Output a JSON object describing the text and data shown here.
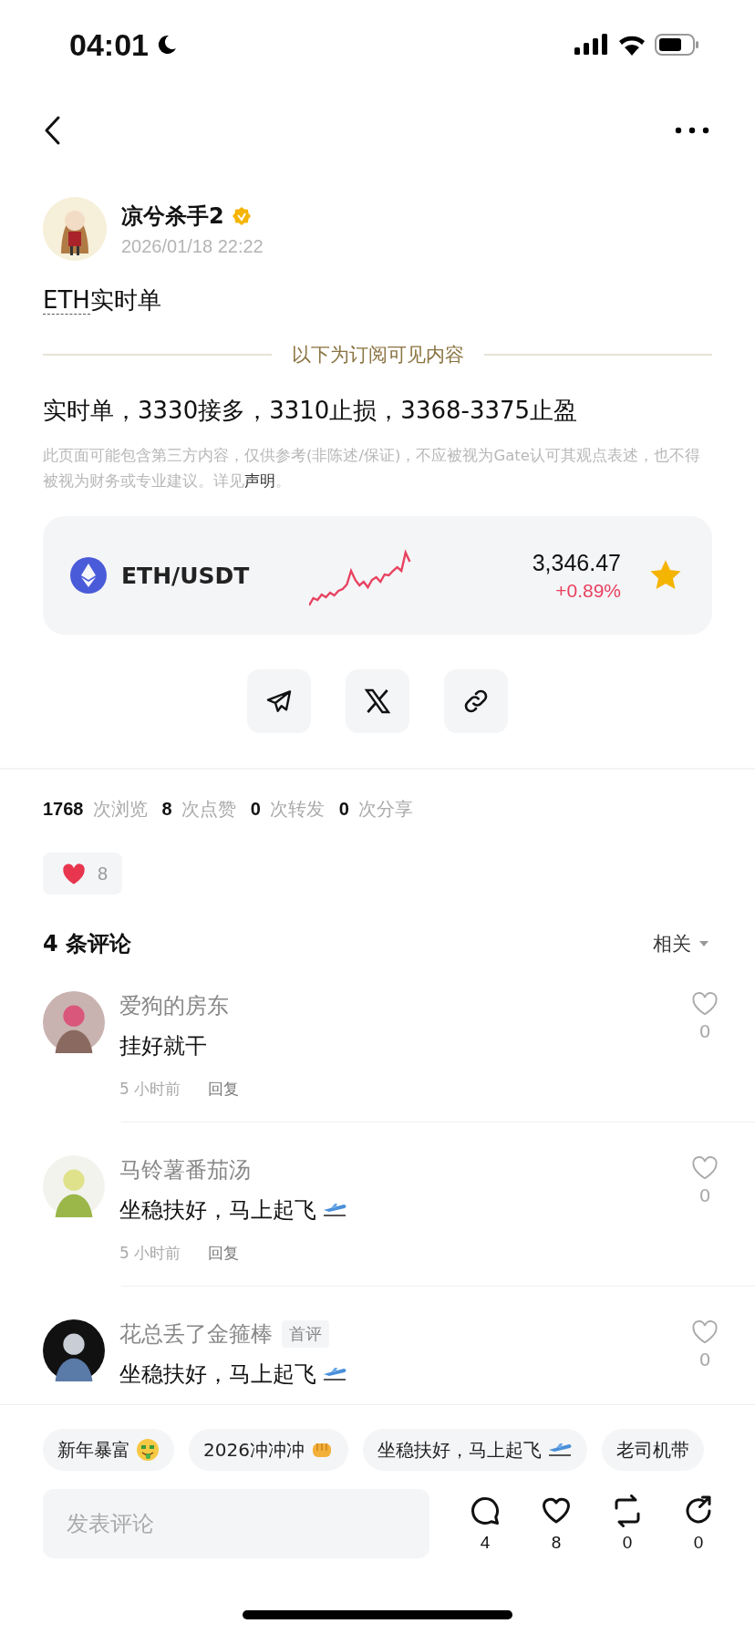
{
  "status_bar": {
    "time": "04:01"
  },
  "author": {
    "name": "凉兮杀手2",
    "verified": true,
    "date": "2026/01/18 22:22"
  },
  "post": {
    "title_tag": "ETH",
    "title_rest": "实时单",
    "divider_label": "以下为订阅可见内容",
    "body": "实时单，3330接多，3310止损，3368-3375止盈",
    "disclaimer": "此页面可能包含第三方内容，仅供参考(非陈述/保证)，不应被视为Gate认可其观点表述，也不得被视为财务或专业建议。详见",
    "disclaimer_link": "声明",
    "disclaimer_end": "。"
  },
  "market": {
    "pair": "ETH/USDT",
    "price": "3,346.47",
    "change": "+0.89%",
    "favorite": true
  },
  "share_buttons": [
    {
      "kind": "telegram"
    },
    {
      "kind": "x"
    },
    {
      "kind": "link"
    }
  ],
  "stats": [
    {
      "count": "1768",
      "label": "次浏览"
    },
    {
      "count": "8",
      "label": "次点赞"
    },
    {
      "count": "0",
      "label": "次转发"
    },
    {
      "count": "0",
      "label": "次分享"
    }
  ],
  "reaction": {
    "count": "8"
  },
  "comments_header": {
    "title": "4 条评论",
    "sort": "相关"
  },
  "comments": [
    {
      "name": "爱狗的房东",
      "text": "挂好就干",
      "kind": "plain",
      "time": "5 小时前",
      "reply": "回复",
      "likes": "0"
    },
    {
      "name": "马铃薯番茄汤",
      "text": "坐稳扶好，马上起飞",
      "kind": "plane",
      "time": "5 小时前",
      "reply": "回复",
      "likes": "0"
    },
    {
      "name": "花总丢了金箍棒",
      "badge": "首评",
      "text": "坐稳扶好，马上起飞",
      "kind": "plane",
      "likes": "0"
    }
  ],
  "quick_replies": [
    {
      "text": "新年暴富",
      "kind": "money"
    },
    {
      "text": "2026冲冲冲",
      "kind": "fist"
    },
    {
      "text": "坐稳扶好，马上起飞",
      "kind": "plane"
    },
    {
      "text": "老司机带",
      "kind": "plain"
    }
  ],
  "composer": {
    "placeholder": "发表评论"
  },
  "actions": [
    {
      "kind": "comment",
      "count": "4"
    },
    {
      "kind": "like",
      "count": "8"
    },
    {
      "kind": "repost",
      "count": "0"
    },
    {
      "kind": "share",
      "count": "0"
    }
  ]
}
